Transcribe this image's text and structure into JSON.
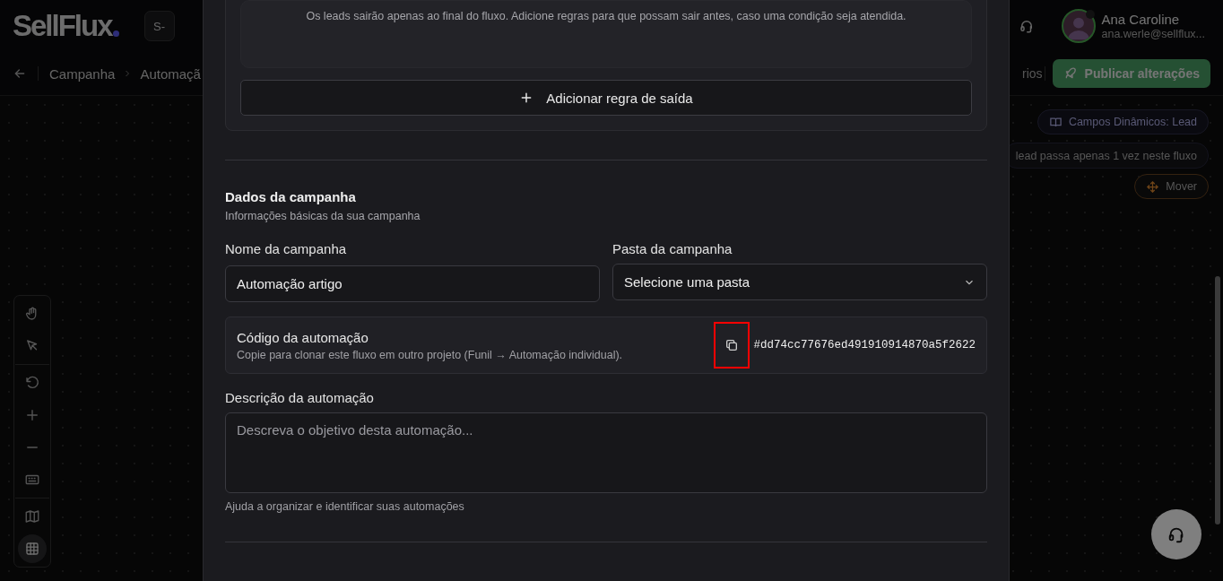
{
  "header": {
    "logo": "SellFlux",
    "workspace_badge": "S-",
    "user": {
      "name": "Ana Caroline",
      "email": "ana.werle@sellflux..."
    }
  },
  "breadcrumb": [
    {
      "label": "Campanha"
    },
    {
      "label": "Automaçã"
    }
  ],
  "toolbar": {
    "menu_fragment": "rios",
    "publish_button": "Publicar alterações"
  },
  "canvas_tools": [
    [
      {
        "kind": "hand",
        "selected": false
      },
      {
        "kind": "pointer",
        "selected": false
      }
    ],
    [
      {
        "kind": "undo",
        "selected": false
      },
      {
        "kind": "zoom-in",
        "selected": false
      },
      {
        "kind": "zoom-out",
        "selected": false
      },
      {
        "kind": "keyboard",
        "selected": false
      }
    ],
    [
      {
        "kind": "map",
        "selected": false
      },
      {
        "kind": "grid",
        "selected": true
      }
    ]
  ],
  "canvas_chips": [
    {
      "kind": "fields",
      "label": "Campos Dinâmicos: Lead"
    },
    {
      "kind": "info",
      "label": "lead passa apenas 1 vez neste fluxo"
    },
    {
      "kind": "move",
      "label": "Mover"
    }
  ],
  "modal": {
    "exit_rules": {
      "empty_message": "Os leads sairão apenas ao final do fluxo. Adicione regras para que possam sair antes, caso uma condição seja atendida.",
      "add_button": "Adicionar regra de saída"
    },
    "campaign": {
      "title": "Dados da campanha",
      "subtitle": "Informações básicas da sua campanha",
      "fields": [
        {
          "kind": "text",
          "label": "Nome da campanha",
          "value": "Automação artigo"
        },
        {
          "kind": "select",
          "label": "Pasta da campanha",
          "placeholder": "Selecione uma pasta"
        }
      ]
    },
    "code": {
      "title": "Código da automação",
      "description": "Copie para clonar este fluxo em outro projeto (Funil → Automação individual).",
      "value": "#dd74cc77676ed491910914870a5f2622",
      "highlighted": true
    },
    "description": {
      "label": "Descrição da automação",
      "placeholder": "Descreva o objetivo desta automação...",
      "hint": "Ajuda a organizar e identificar suas automações"
    }
  }
}
